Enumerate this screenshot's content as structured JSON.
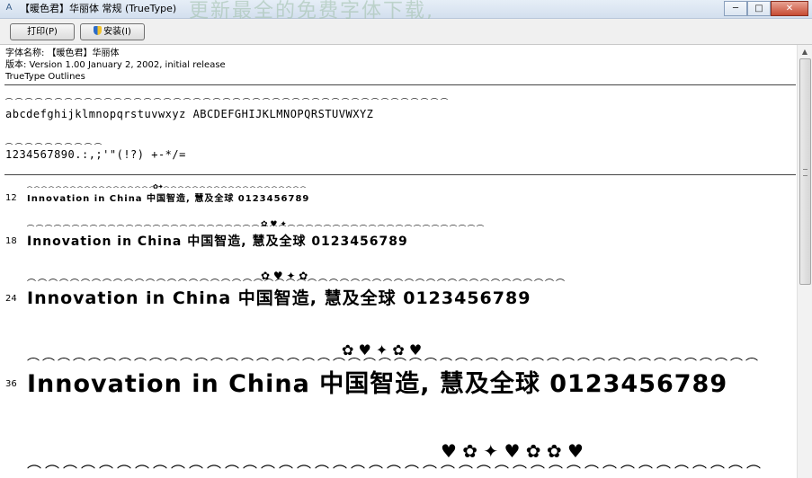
{
  "window": {
    "title": "【暖色君】华丽体 常规 (TrueType)",
    "background_overlay_text": "更新最全的免费字体下载,",
    "app_icon": "font-viewer-icon",
    "controls": {
      "minimize": "─",
      "maximize": "□",
      "close": "✕"
    }
  },
  "toolbar": {
    "print_label": "打印(P)",
    "install_label": "安装(I)",
    "install_icon": "shield-icon"
  },
  "info": {
    "font_name": "字体名称: 【暖色君】华丽体",
    "version": "版本: Version 1.00 January 2, 2002, initial release",
    "outline": "TrueType Outlines"
  },
  "charset": {
    "letters": "abcdefghijklmnopqrstuvwxyz ABCDEFGHIJKLMNOPQRSTUVWXYZ",
    "digits": "1234567890.:,;'\"(!?) +-*/="
  },
  "samples": [
    {
      "size": "12",
      "text": "Innovation in China 中国智造, 慧及全球 0123456789"
    },
    {
      "size": "18",
      "text": "Innovation in China 中国智造, 慧及全球 0123456789"
    },
    {
      "size": "24",
      "text": "Innovation in China 中国智造, 慧及全球 0123456789"
    },
    {
      "size": "36",
      "text": "Innovation in China 中国智造, 慧及全球 0123456789"
    }
  ],
  "colors": {
    "titlebar": "#d3dfee",
    "close_button": "#c74b33",
    "text": "#000000"
  }
}
